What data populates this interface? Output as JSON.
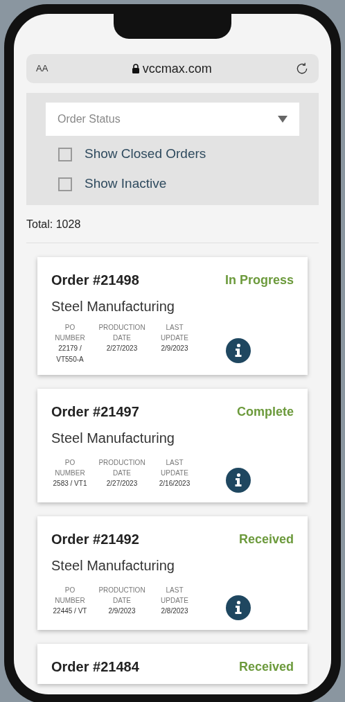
{
  "browser": {
    "text_size": "AA",
    "url": "vccmax.com"
  },
  "filters": {
    "dropdown": {
      "placeholder": "Order Status"
    },
    "checkboxes": [
      {
        "label": "Show Closed Orders",
        "checked": false
      },
      {
        "label": "Show Inactive",
        "checked": false
      }
    ]
  },
  "total": "Total: 1028",
  "orders": [
    {
      "title": "Order #21498",
      "status": "In Progress",
      "customer": "Steel Manufacturing",
      "columns": [
        "PO NUMBER",
        "PRODUCTION DATE",
        "LAST UPDATE"
      ],
      "values": [
        "22179 / VT550-A",
        "2/27/2023",
        "2/9/2023"
      ]
    },
    {
      "title": "Order #21497",
      "status": "Complete",
      "customer": "Steel Manufacturing",
      "columns": [
        "PO NUMBER",
        "PRODUCTION DATE",
        "LAST UPDATE"
      ],
      "values": [
        "2583 / VT1",
        "2/27/2023",
        "2/16/2023"
      ]
    },
    {
      "title": "Order #21492",
      "status": "Received",
      "customer": "Steel Manufacturing",
      "columns": [
        "PO NUMBER",
        "PRODUCTION DATE",
        "LAST UPDATE"
      ],
      "values": [
        "22445 / VT",
        "2/9/2023",
        "2/8/2023"
      ]
    },
    {
      "title": "Order #21484",
      "status": "Received"
    }
  ]
}
